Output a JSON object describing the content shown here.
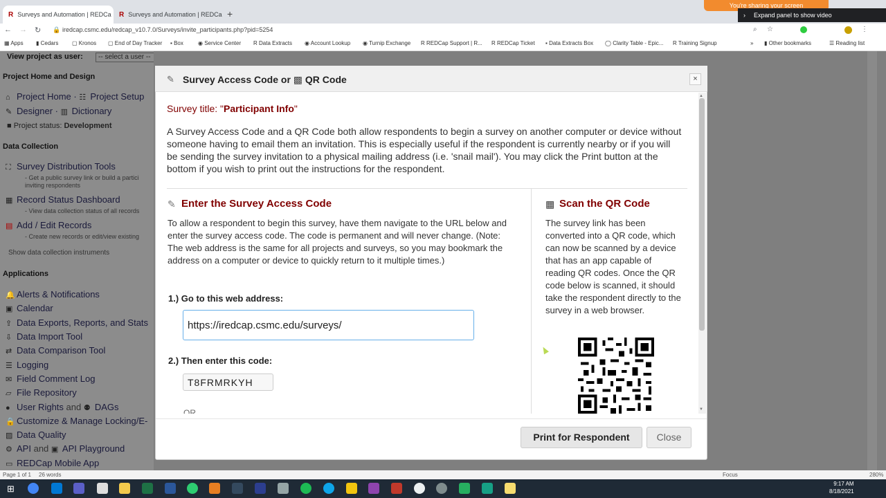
{
  "browser": {
    "tabs": [
      {
        "title": "Surveys and Automation | REDCa",
        "active": true
      },
      {
        "title": "Surveys and Automation | REDCa",
        "active": false
      }
    ],
    "new_tab_label": "+",
    "sharing_banner": "You're sharing your screen",
    "expand_panel": "Expand panel to show video",
    "url": "iredcap.csmc.edu/redcap_v10.7.0/Surveys/invite_participants.php?pid=5254",
    "bookmarks": [
      "Apps",
      "Cedars",
      "Kronos",
      "End of Day Tracker",
      "Box",
      "Service Center",
      "Data Extracts",
      "Account Lookup",
      "Turnip Exchange",
      "REDCap Support | R...",
      "REDCap Ticket",
      "Data Extracts Box",
      "Clarity Table - Epic...",
      "Training Signup",
      "Other bookmarks",
      "Reading list"
    ]
  },
  "sidebar": {
    "view_as": "View project as user:",
    "select_user": "-- select a user --",
    "project_home_heading": "Project Home and Design",
    "project_home": "Project Home",
    "project_setup": "Project Setup",
    "designer": "Designer",
    "dictionary": "Dictionary",
    "project_status_label": "Project status:",
    "project_status": "Development",
    "data_collection_heading": "Data Collection",
    "survey_dist": "Survey Distribution Tools",
    "survey_dist_sub1": "- Get a public survey link or build a partici",
    "survey_dist_sub2": "inviting respondents",
    "record_status": "Record Status Dashboard",
    "record_status_sub": "- View data collection status of all records",
    "add_edit": "Add / Edit Records",
    "add_edit_sub": "- Create new records or edit/view existing",
    "show_instruments": "Show data collection instruments",
    "applications_heading": "Applications",
    "apps": [
      "Alerts & Notifications",
      "Calendar",
      "Data Exports, Reports, and Stats",
      "Data Import Tool",
      "Data Comparison Tool",
      "Logging",
      "Field Comment Log",
      "File Repository",
      "User Rights",
      "Customize & Manage Locking/E-",
      "Data Quality",
      "API",
      "REDCap Mobile App"
    ],
    "and1": "and",
    "dags": "DAGs",
    "and2": "and",
    "api_playground": "API Playground"
  },
  "dialog": {
    "title_part1": "Survey Access Code or",
    "title_part2": "QR Code",
    "close_x": "×",
    "survey_title_label": "Survey title: \"",
    "survey_title": "Participant Info",
    "survey_title_end": "\"",
    "intro": "A Survey Access Code and a QR Code both allow respondents to begin a survey on another computer or device without someone having to email them an invitation. This is especially useful if the respondent is currently nearby or if you will be sending the survey invitation to a physical mailing address (i.e. 'snail mail'). You may click the Print button at the bottom if you wish to print out the instructions for the respondent.",
    "left_heading": "Enter the Survey Access Code",
    "left_desc": "To allow a respondent to begin this survey, have them navigate to the URL below and enter the survey access code. The code is permanent and will never change. (Note: The web address is the same for all projects and surveys, so you may bookmark the address on a computer or device to quickly return to it multiple times.)",
    "step1": "1.) Go to this web address:",
    "survey_url": "https://iredcap.csmc.edu/surveys/",
    "step2": "2.) Then enter this code:",
    "access_code": "T8FRMRKYH",
    "or_text": "OR",
    "right_heading": "Scan the QR Code",
    "right_desc": "The survey link has been converted into a QR code, which can now be scanned by a device that has an app capable of reading QR codes. Once the QR code below is scanned, it should take the respondent directly to the survey in a web browser.",
    "print_button": "Print for Respondent",
    "close_button": "Close"
  },
  "statusbar": {
    "page": "Page 1 of 1",
    "words": "26 words",
    "focus": "Focus",
    "zoom": "280%"
  },
  "clock": {
    "time": "9:17 AM",
    "date": "8/18/2021"
  }
}
